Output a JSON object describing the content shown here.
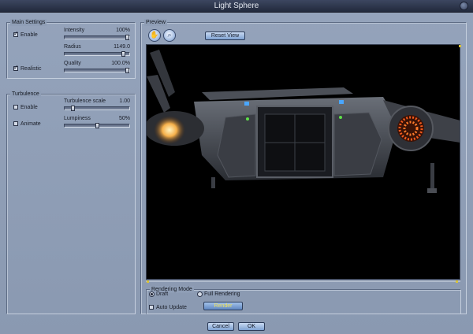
{
  "window": {
    "title": "Light Sphere"
  },
  "main_settings": {
    "title": "Main Settings",
    "enable": {
      "label": "Enable",
      "checked": true
    },
    "realistic": {
      "label": "Realistic",
      "checked": true
    },
    "intensity": {
      "label": "Intensity",
      "value": "100%",
      "fraction": 1.0
    },
    "radius": {
      "label": "Radius",
      "value": "1149.0",
      "fraction": 0.93
    },
    "quality": {
      "label": "Quality",
      "value": "100.0%",
      "fraction": 1.0
    }
  },
  "turbulence": {
    "title": "Turbulence",
    "enable": {
      "label": "Enable",
      "checked": false
    },
    "animate": {
      "label": "Animate",
      "checked": false
    },
    "turbulence_scale": {
      "label": "Turbulence scale",
      "value": "1.00",
      "fraction": 0.1
    },
    "lumpiness": {
      "label": "Lumpiness",
      "value": "50%",
      "fraction": 0.5
    }
  },
  "preview": {
    "title": "Preview",
    "reset_view_label": "Reset View",
    "pan_icon": "hand-icon",
    "zoom_icon": "magnifier-icon"
  },
  "rendering": {
    "title": "Rendering Mode",
    "draft_label": "Draft",
    "full_label": "Full Rendering",
    "mode_selected": "Draft",
    "auto_update_label": "Auto Update",
    "auto_update_checked": false,
    "render_label": "Render"
  },
  "footer": {
    "cancel_label": "Cancel",
    "ok_label": "OK"
  },
  "colors": {
    "window_bg": "#8b9bb4",
    "button_gradient_top": "#c9daf2",
    "render_text": "#f0e25a",
    "engine_glow": "#f08a2a"
  }
}
